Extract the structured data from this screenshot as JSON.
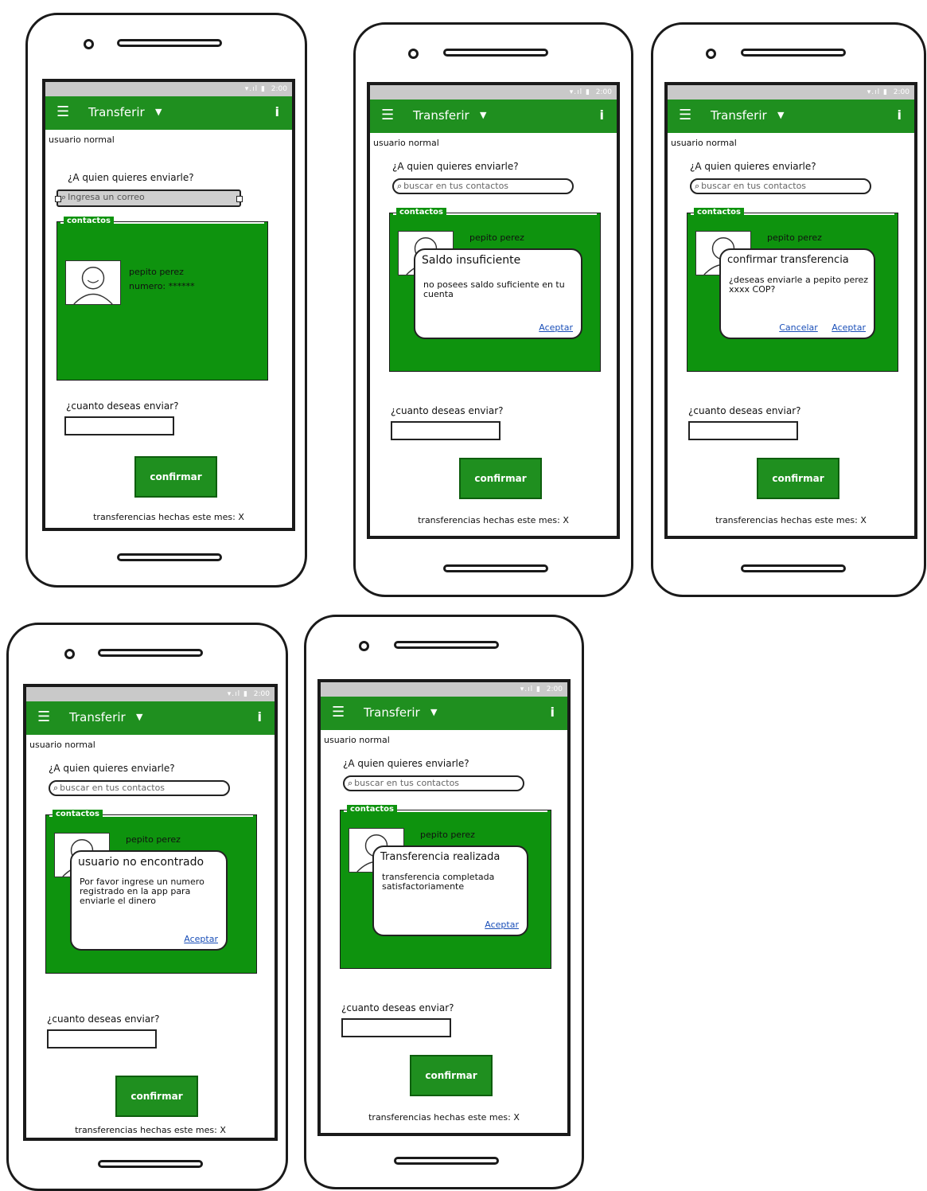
{
  "app": {
    "title": "Transferir",
    "user_label": "usuario normal",
    "question": "¿A quien quieres enviarle?",
    "search_placeholder": "buscar en tus contactos",
    "search_placeholder_first": "Ingresa un correo",
    "contacts_title": "contactos",
    "contact_name": "pepito perez",
    "contact_number": "numero: ******",
    "amount_label": "¿cuanto deseas enviar?",
    "confirm_label": "confirmar",
    "footer": "transferencias hechas este mes: X",
    "status_time": "2:00",
    "status_signal": "▾.ıl ▮",
    "accent": "#1f8f1f"
  },
  "dialogs": {
    "insufficient": {
      "title": "Saldo insuficiente",
      "body": "no posees saldo suficiente en tu cuenta",
      "ok": "Aceptar"
    },
    "confirm": {
      "title": "confirmar transferencia",
      "body": "¿deseas enviarle a pepito perez xxxx COP?",
      "cancel": "Cancelar",
      "ok": "Aceptar"
    },
    "not_found": {
      "title": "usuario no encontrado",
      "body": "Por favor ingrese un numero registrado en la app para enviarle el dinero",
      "ok": "Aceptar"
    },
    "success": {
      "title": "Transferencia realizada",
      "body": "transferencia completada satisfactoriamente",
      "ok": "Aceptar"
    }
  }
}
